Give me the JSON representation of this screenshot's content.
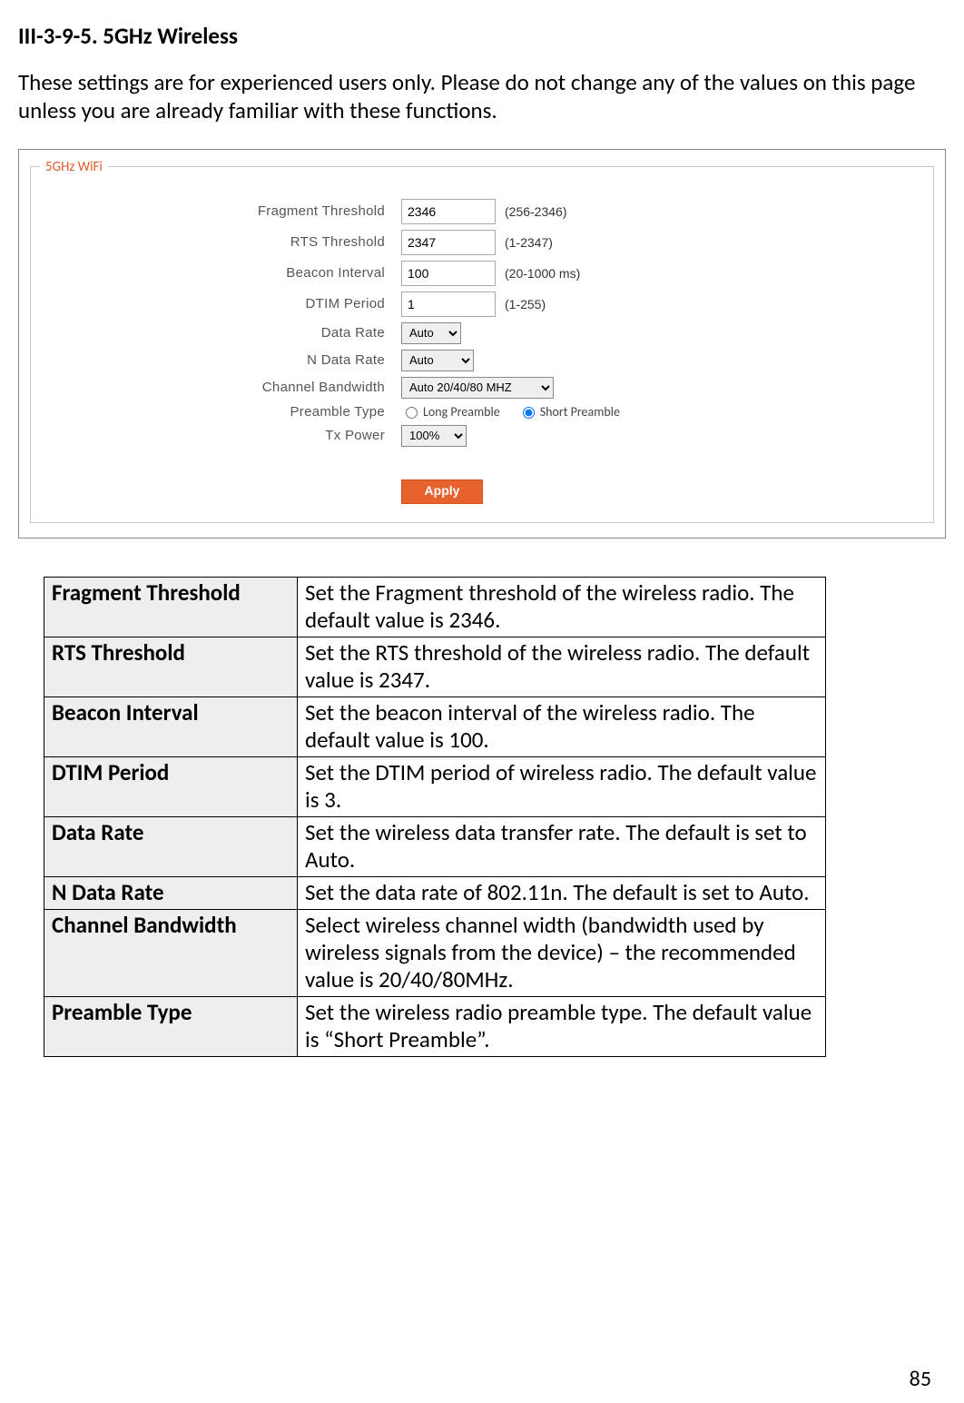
{
  "heading": "III-3-9-5.    5GHz Wireless",
  "intro": "These settings are for experienced users only. Please do not change any of the values on this page unless you are already familiar with these functions.",
  "fieldset": {
    "legend": "5GHz WiFi",
    "rows": {
      "fragment": {
        "label": "Fragment Threshold",
        "value": "2346",
        "hint": "(256-2346)"
      },
      "rts": {
        "label": "RTS Threshold",
        "value": "2347",
        "hint": "(1-2347)"
      },
      "beacon": {
        "label": "Beacon Interval",
        "value": "100",
        "hint": "(20-1000 ms)"
      },
      "dtim": {
        "label": "DTIM Period",
        "value": "1",
        "hint": "(1-255)"
      },
      "datarate": {
        "label": "Data Rate",
        "value": "Auto"
      },
      "ndatarate": {
        "label": "N Data Rate",
        "value": "Auto"
      },
      "chbw": {
        "label": "Channel Bandwidth",
        "value": "Auto 20/40/80 MHZ"
      },
      "preamble": {
        "label": "Preamble Type",
        "long_label": "Long Preamble",
        "short_label": "Short Preamble"
      },
      "txpower": {
        "label": "Tx Power",
        "value": "100%"
      }
    },
    "apply_label": "Apply"
  },
  "table": {
    "rows": [
      {
        "k": "Fragment Threshold",
        "v": "Set the Fragment threshold of the wireless radio. The default value is 2346."
      },
      {
        "k": "RTS Threshold",
        "v": "Set the RTS threshold of the wireless radio. The default value is 2347."
      },
      {
        "k": "Beacon Interval",
        "v": "Set the beacon interval of the wireless radio. The default value is 100."
      },
      {
        "k": "DTIM Period",
        "v": "Set the DTIM period of wireless radio. The default value is 3."
      },
      {
        "k": "Data Rate",
        "v": "Set the wireless data transfer rate. The default is set to Auto."
      },
      {
        "k": "N Data Rate",
        "v": "Set the data rate of 802.11n. The default is set to Auto."
      },
      {
        "k": "Channel Bandwidth",
        "v": "Select wireless channel width (bandwidth used by wireless signals from the device) – the recommended value is 20/40/80MHz."
      },
      {
        "k": "Preamble Type",
        "v": "Set the wireless radio preamble type. The default value is “Short Preamble”."
      }
    ]
  },
  "page_number": "85"
}
